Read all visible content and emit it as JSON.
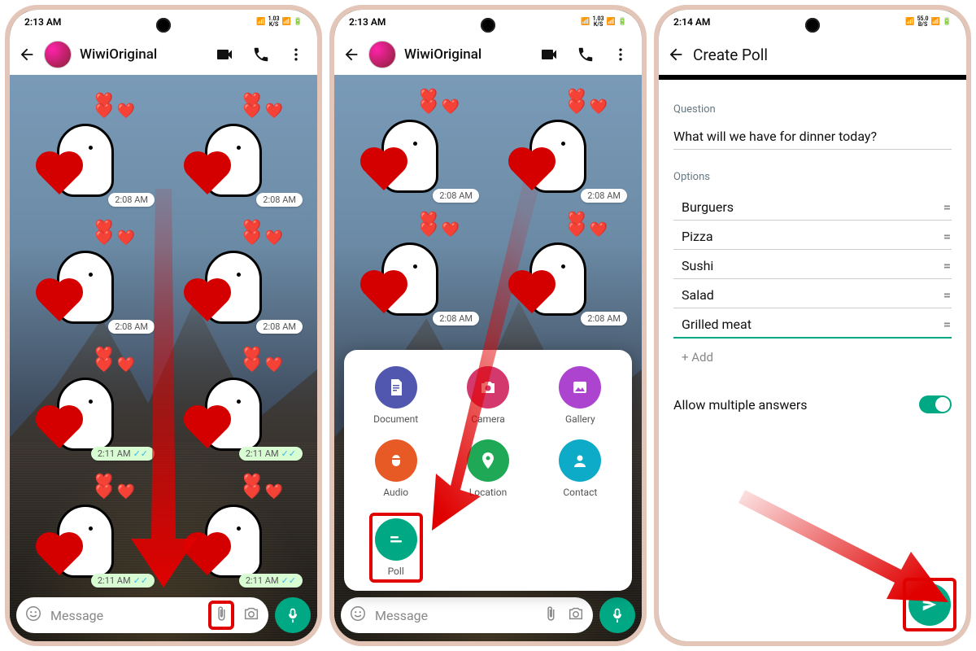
{
  "screens": {
    "s1": {
      "time": "2:13 AM",
      "net": "1.03",
      "netu": "K/S",
      "batt": "328"
    },
    "s2": {
      "time": "2:13 AM",
      "net": "1.03",
      "netu": "K/S",
      "batt": "328"
    },
    "s3": {
      "time": "2:14 AM",
      "net": "55.0",
      "netu": "B/S",
      "batt": "328"
    }
  },
  "chat": {
    "name": "WiwiOriginal",
    "message_placeholder": "Message",
    "stickers": [
      {
        "time": "2:08 AM",
        "sent": false
      },
      {
        "time": "2:08 AM",
        "sent": false
      },
      {
        "time": "2:08 AM",
        "sent": false
      },
      {
        "time": "2:08 AM",
        "sent": false
      },
      {
        "time": "2:11 AM",
        "sent": true
      },
      {
        "time": "2:11 AM",
        "sent": true
      },
      {
        "time": "2:11 AM",
        "sent": true
      },
      {
        "time": "2:11 AM",
        "sent": true
      }
    ]
  },
  "attach": {
    "document": "Document",
    "camera": "Camera",
    "gallery": "Gallery",
    "audio": "Audio",
    "location": "Location",
    "contact": "Contact",
    "poll": "Poll"
  },
  "poll": {
    "title": "Create Poll",
    "question_label": "Question",
    "question_value": "What will we have for dinner today?",
    "options_label": "Options",
    "options": [
      "Burguers",
      "Pizza",
      "Sushi",
      "Salad",
      "Grilled meat"
    ],
    "add_label": "+ Add",
    "allow_label": "Allow multiple answers"
  }
}
